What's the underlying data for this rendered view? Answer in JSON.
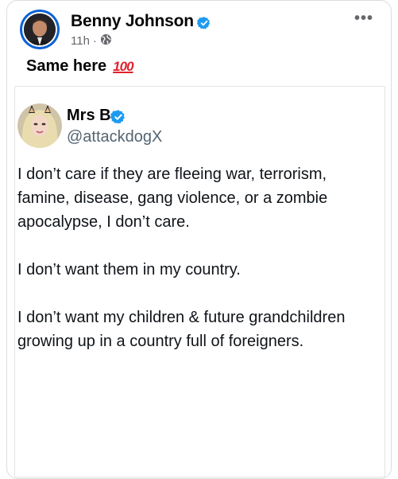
{
  "post": {
    "author_name": "Benny Johnson",
    "time": "11h",
    "separator": "·",
    "text": "Same here",
    "emoji": "100",
    "more_icon": "more-options-icon",
    "audience_icon": "globe-icon"
  },
  "embedded_tweet": {
    "name": "Mrs B",
    "handle": "@attackdogX",
    "paragraphs": [
      "I don’t care if they are fleeing war, terrorism, famine, disease, gang violence, or a zombie apocalypse, I don’t care.",
      "I don’t want them in my country.",
      "I don’t want my children & future grandchildren growing up in a country full of foreigners."
    ]
  },
  "colors": {
    "verified": "#1d9bf0",
    "profile_ring": "#0b62d6",
    "emoji_red": "#e0232e"
  }
}
